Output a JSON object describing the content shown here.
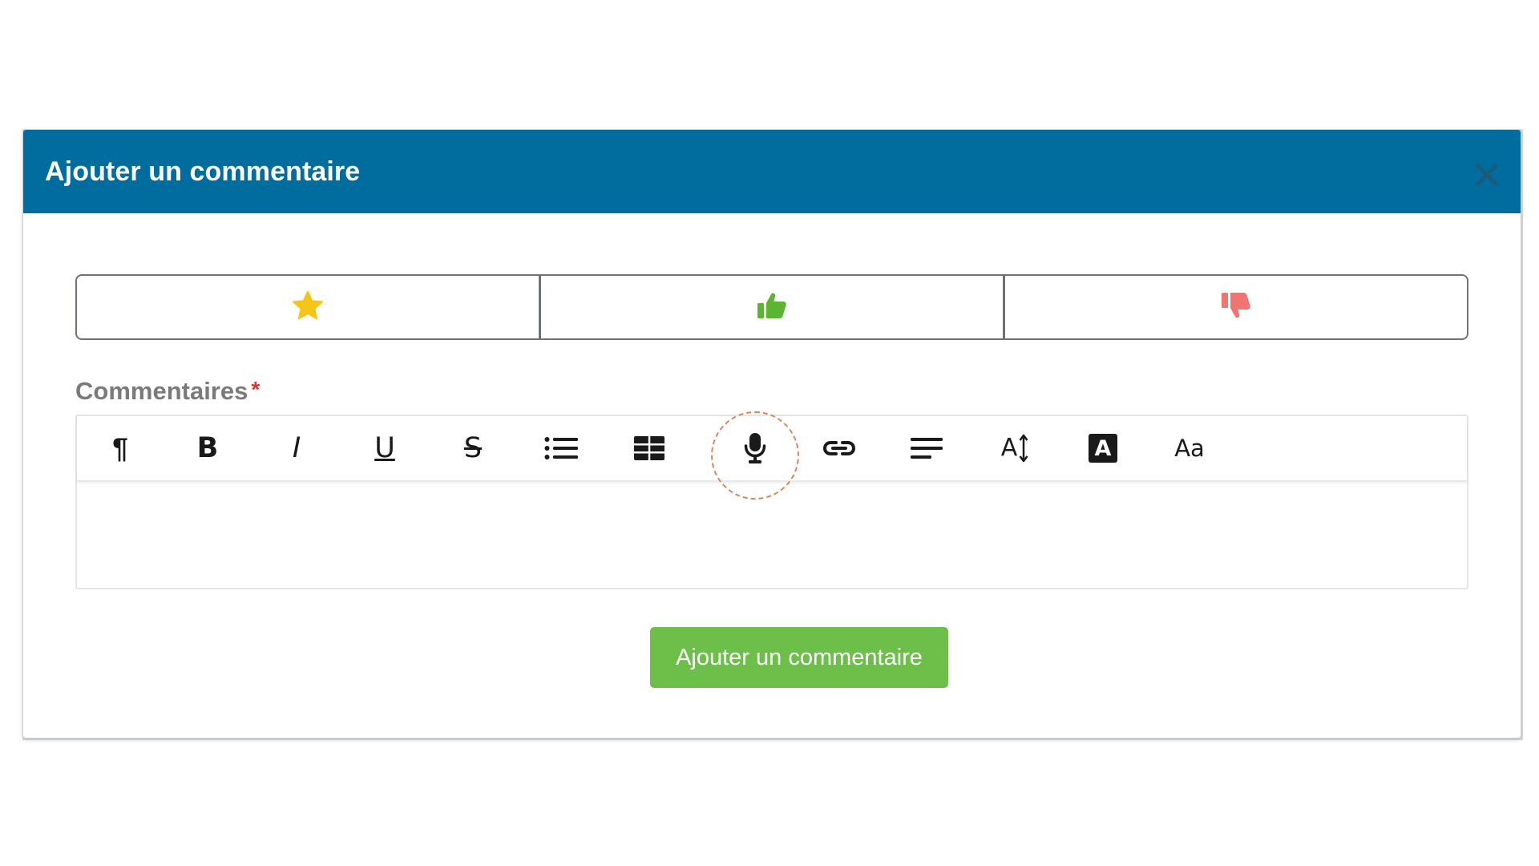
{
  "modal": {
    "title": "Ajouter un commentaire",
    "close_icon": "close-icon"
  },
  "rating": {
    "options": [
      {
        "icon": "star-icon",
        "color": "#f5c518"
      },
      {
        "icon": "thumbs-up-icon",
        "color": "#5cb531"
      },
      {
        "icon": "thumbs-down-icon",
        "color": "#f07470"
      }
    ]
  },
  "comments": {
    "label": "Commentaires",
    "required_marker": "*",
    "required_color": "#e0322e",
    "body_value": ""
  },
  "toolbar": {
    "paragraph_glyph": "¶",
    "bold_glyph": "B",
    "italic_glyph": "I",
    "underline_glyph": "U",
    "strikethrough_glyph": "S",
    "font_size_glyph": "A",
    "highlight_glyph": "A",
    "text_case_glyph": "Aa",
    "items": [
      {
        "icon": "paragraph-icon"
      },
      {
        "icon": "bold-icon"
      },
      {
        "icon": "italic-icon"
      },
      {
        "icon": "underline-icon"
      },
      {
        "icon": "strikethrough-icon"
      },
      {
        "icon": "bulleted-list-icon"
      },
      {
        "icon": "table-icon"
      },
      {
        "icon": "microphone-icon",
        "highlighted": true
      },
      {
        "icon": "link-icon"
      },
      {
        "icon": "align-icon"
      },
      {
        "icon": "font-size-icon"
      },
      {
        "icon": "text-highlight-icon"
      },
      {
        "icon": "text-case-icon"
      }
    ]
  },
  "submit": {
    "label": "Ajouter un commentaire",
    "color": "#6cc04a"
  },
  "colors": {
    "header_bg": "#006d9e",
    "header_text": "#ffffff",
    "label_text": "#7a7a7a"
  }
}
